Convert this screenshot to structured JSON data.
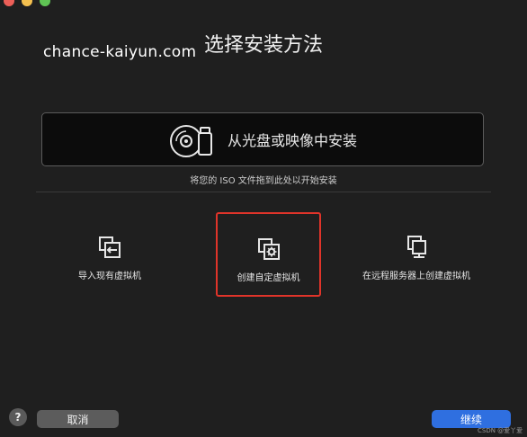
{
  "window": {
    "title": "选择安装方法",
    "watermark": "chance-kaiyun.com"
  },
  "disc": {
    "label": "从光盘或映像中安装",
    "hint": "将您的 ISO 文件拖到此处以开始安装"
  },
  "options": [
    {
      "label": "导入现有虚拟机",
      "icon": "import-vm-icon"
    },
    {
      "label": "创建自定虚拟机",
      "icon": "custom-vm-icon",
      "selected": true
    },
    {
      "label": "在远程服务器上创建虚拟机",
      "icon": "remote-server-icon"
    }
  ],
  "footer": {
    "help": "?",
    "cancel": "取消",
    "continue": "继续",
    "credit": "CSDN @爱丫爱"
  },
  "colors": {
    "background": "#1f1f1f",
    "selection_border": "#e0342a",
    "primary_button": "#2f6fe0",
    "secondary_button": "#5c5c5c"
  }
}
